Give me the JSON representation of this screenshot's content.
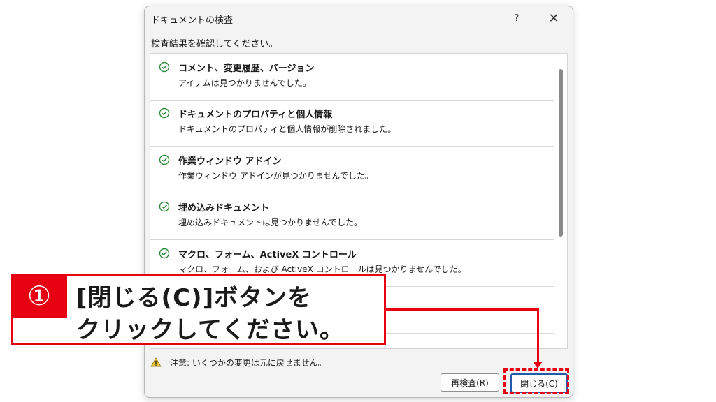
{
  "dialog": {
    "title": "ドキュメントの検査",
    "help_label": "?",
    "close_label": "✕",
    "instruction": "検査結果を確認してください。",
    "results": [
      {
        "title": "コメント、変更履歴、バージョン",
        "desc": "アイテムは見つかりませんでした。"
      },
      {
        "title": "ドキュメントのプロパティと個人情報",
        "desc": "ドキュメントのプロパティと個人情報が削除されました。"
      },
      {
        "title": "作業ウィンドウ アドイン",
        "desc": "作業ウィンドウ アドインが見つかりませんでした。"
      },
      {
        "title": "埋め込みドキュメント",
        "desc": "埋め込みドキュメントは見つかりませんでした。"
      },
      {
        "title": "マクロ、フォーム、ActiveX コントロール",
        "desc": "マクロ、フォーム、および ActiveX コントロールは見つかりませんでした。"
      }
    ],
    "warning_text": "注意: いくつかの変更は元に戻せません。",
    "reinspect_label": "再検査(R)",
    "close_button_label": "閉じる(C)",
    "check_icon": "check-circle-icon",
    "warning_icon": "warning-triangle-icon"
  },
  "callout": {
    "number": "①",
    "line1": "[閉じる(C)]ボタンを",
    "line2": "クリックしてください。",
    "accent_color": "#e60012"
  }
}
